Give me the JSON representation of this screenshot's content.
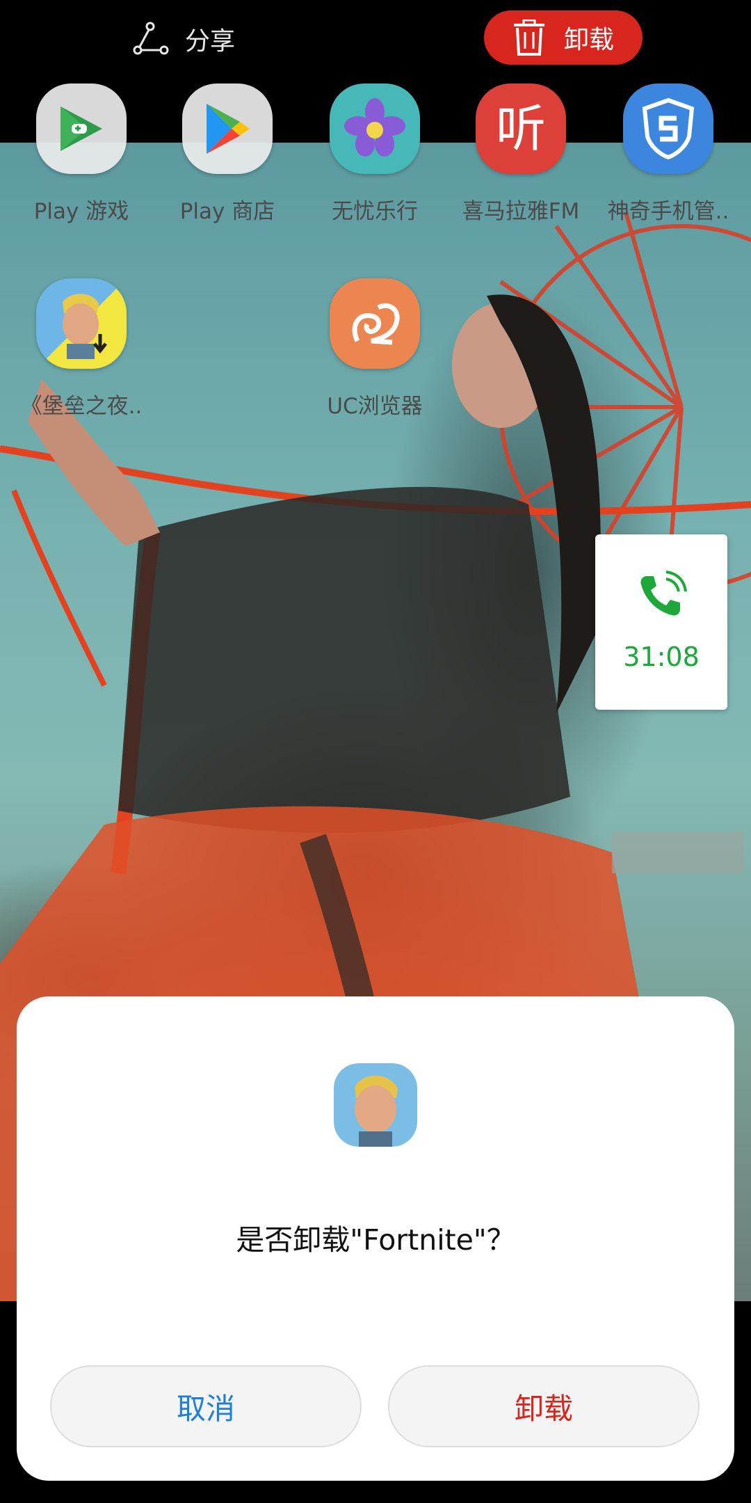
{
  "topbar": {
    "share_label": "分享",
    "uninstall_label": "卸载"
  },
  "apps": [
    {
      "label": "Play 游戏",
      "icon": "play-games-icon"
    },
    {
      "label": "Play 商店",
      "icon": "play-store-icon"
    },
    {
      "label": "无忧乐行",
      "icon": "wuyou-lexing-icon"
    },
    {
      "label": "喜马拉雅FM",
      "icon": "ximalaya-icon"
    },
    {
      "label": "神奇手机管..",
      "icon": "phone-manager-shield-icon"
    },
    {
      "label": "《堡垒之夜..",
      "icon": "fortnite-download-icon"
    },
    {
      "label": "UC浏览器",
      "icon": "uc-browser-icon"
    }
  ],
  "call": {
    "duration": "31:08",
    "icon": "phone-call-icon"
  },
  "dialog": {
    "message": "是否卸载\"Fortnite\"？",
    "cancel_label": "取消",
    "confirm_label": "卸载",
    "icon": "fortnite-icon"
  },
  "colors": {
    "accent_red": "#d8261f",
    "link_blue": "#1e7fd8",
    "call_green": "#1fa83a"
  }
}
